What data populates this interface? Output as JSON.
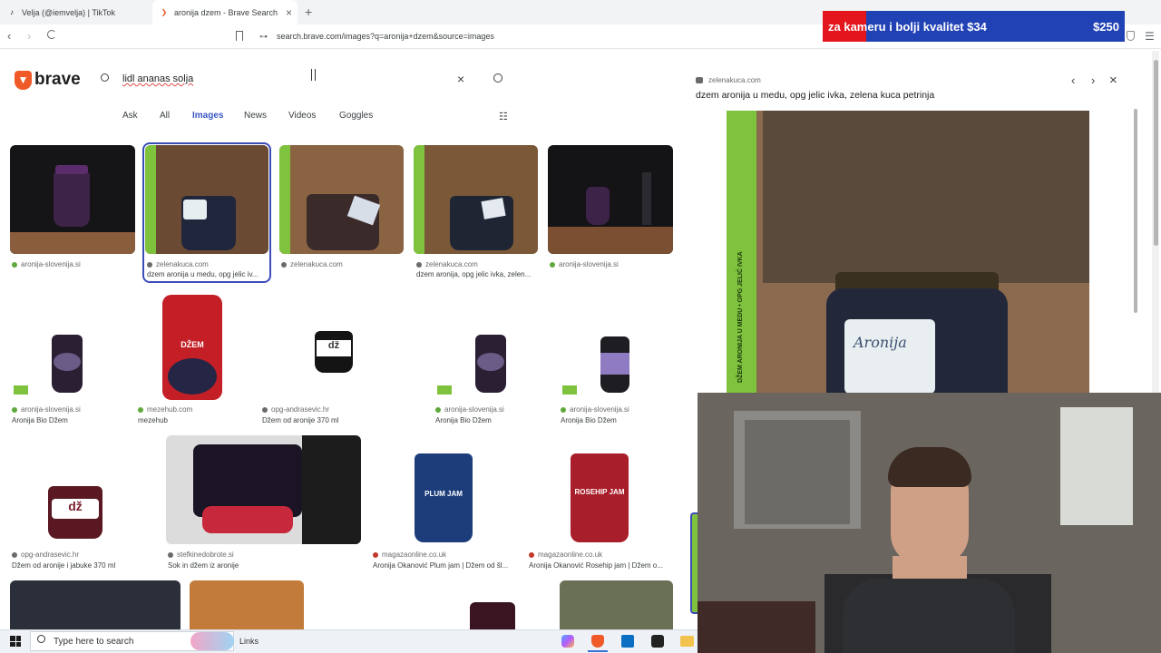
{
  "tabs": [
    {
      "icon": "tiktok-icon",
      "title": "Velja (@iemvelja) | TikTok"
    },
    {
      "icon": "brave-icon",
      "title": "aronija dzem - Brave Search"
    }
  ],
  "address_bar": {
    "url": "search.brave.com/images?q=aronija+dzem&source=images"
  },
  "banner": {
    "text": "za kameru i bolji kvalitet $34",
    "amount": "$250"
  },
  "brand": {
    "name": "brave"
  },
  "search": {
    "query": "lidl ananas solja"
  },
  "nav_tabs": [
    "Ask",
    "All",
    "Images",
    "News",
    "Videos",
    "Goggles"
  ],
  "results": {
    "row1": [
      {
        "source": "aronija-slovenija.si",
        "caption": ""
      },
      {
        "source": "zelenakuca.com",
        "caption": "dzem aronija u medu, opg jelic iv..."
      },
      {
        "source": "zelenakuca.com",
        "caption": ""
      },
      {
        "source": "zelenakuca.com",
        "caption": "dzem aronija, opg jelic ivka, zelen..."
      },
      {
        "source": "aronija-slovenija.si",
        "caption": ""
      }
    ],
    "row2": [
      {
        "source": "aronija-slovenija.si",
        "caption": "Aronija Bio Džem"
      },
      {
        "source": "mezehub.com",
        "caption": "mezehub"
      },
      {
        "source": "opg-andrasevic.hr",
        "caption": "Džem od aronije 370 ml"
      },
      {
        "source": "aronija-slovenija.si",
        "caption": "Aronija Bio Džem"
      },
      {
        "source": "aronija-slovenija.si",
        "caption": "Aronija Bio Džem"
      }
    ],
    "row3": [
      {
        "source": "opg-andrasevic.hr",
        "caption": "Džem od aronije i jabuke 370 ml"
      },
      {
        "source": "stefkinedobrote.si",
        "caption": "Sok in džem iz aronije"
      },
      {
        "source": "magazaonline.co.uk",
        "caption": "Aronija Okanović Plum jam | Džem od šl..."
      },
      {
        "source": "magazaonline.co.uk",
        "caption": "Aronija Okanović Rosehip jam | Džem o..."
      }
    ],
    "jar_labels": {
      "dzem": "DŽEM",
      "aronija": "Aronija",
      "plum": "PLUM JAM",
      "rosehip": "ROSEHIP JAM",
      "dz": "dž"
    }
  },
  "panel": {
    "source": "zelenakuca.com",
    "title": "dzem aronija u medu, opg jelic ivka, zelena kuca petrinja",
    "side_text": "DŽEM ARONIJA U MEDU • OPG JELIĆ IVKA",
    "jar_label": "Aronija"
  },
  "taskbar": {
    "search_placeholder": "Type here to search",
    "links": "Links"
  }
}
